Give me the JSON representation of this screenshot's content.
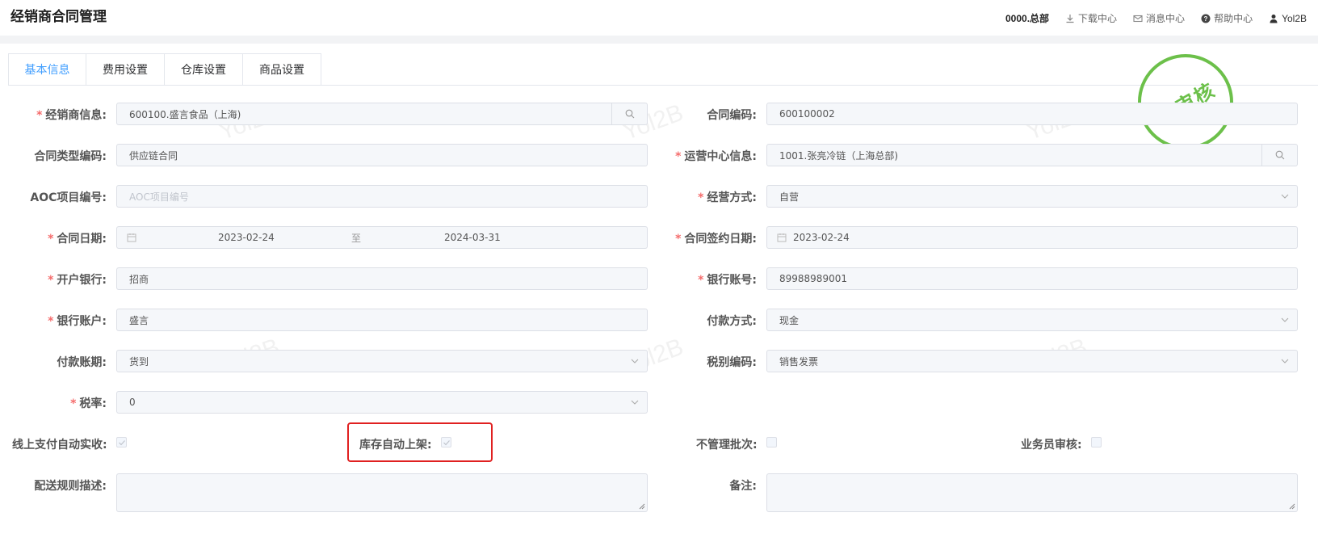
{
  "header": {
    "title": "经销商合同管理",
    "org": "0000.总部",
    "download": "下载中心",
    "messages": "消息中心",
    "help": "帮助中心",
    "user": "Yol2B"
  },
  "tabs": [
    {
      "label": "基本信息",
      "active": true
    },
    {
      "label": "费用设置",
      "active": false
    },
    {
      "label": "仓库设置",
      "active": false
    },
    {
      "label": "商品设置",
      "active": false
    }
  ],
  "stamp": "已审核",
  "watermark": "Yol2B",
  "colors": {
    "accent": "#409eff",
    "required": "#f56c6c",
    "stamp": "#6cc04a",
    "highlight": "#e02020"
  },
  "form": {
    "dealer_info": {
      "label": "经销商信息:",
      "value": "600100.盛言食品（上海)",
      "required": true
    },
    "contract_code": {
      "label": "合同编码:",
      "value": "600100002"
    },
    "contract_type_code": {
      "label": "合同类型编码:",
      "value": "供应链合同"
    },
    "ops_center": {
      "label": "运营中心信息:",
      "value": "1001.张亮冷链（上海总部)",
      "required": true
    },
    "aoc_code": {
      "label": "AOC项目编号:",
      "placeholder": "AOC项目编号"
    },
    "biz_mode": {
      "label": "经营方式:",
      "value": "自营",
      "required": true
    },
    "contract_date": {
      "label": "合同日期:",
      "start": "2023-02-24",
      "separator": "至",
      "end": "2024-03-31",
      "required": true
    },
    "sign_date": {
      "label": "合同签约日期:",
      "value": "2023-02-24",
      "required": true
    },
    "bank": {
      "label": "开户银行:",
      "value": "招商",
      "required": true
    },
    "bank_account_no": {
      "label": "银行账号:",
      "value": "89988989001",
      "required": true
    },
    "bank_account_name": {
      "label": "银行账户:",
      "value": "盛言",
      "required": true
    },
    "payment_method": {
      "label": "付款方式:",
      "value": "现金"
    },
    "payment_term": {
      "label": "付款账期:",
      "value": "货到"
    },
    "tax_code": {
      "label": "税别编码:",
      "value": "销售发票"
    },
    "tax_rate": {
      "label": "税率:",
      "value": "0",
      "required": true
    },
    "online_pay_auto": {
      "label": "线上支付自动实收:",
      "checked": true
    },
    "stock_auto_shelf": {
      "label": "库存自动上架:",
      "checked": true
    },
    "no_batch_mgmt": {
      "label": "不管理批次:",
      "checked": false
    },
    "salesman_audit": {
      "label": "业务员审核:",
      "checked": false
    },
    "delivery_rules": {
      "label": "配送规则描述:",
      "value": ""
    },
    "remarks": {
      "label": "备注:",
      "value": ""
    }
  }
}
